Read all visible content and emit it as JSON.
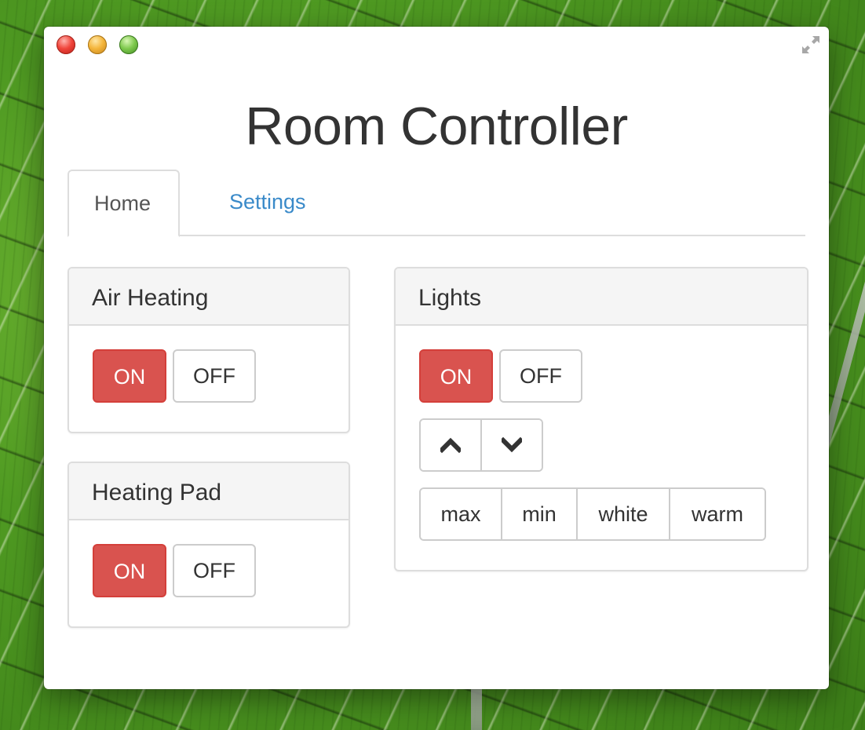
{
  "window": {
    "title": "Room Controller"
  },
  "tabs": [
    {
      "label": "Home",
      "active": true
    },
    {
      "label": "Settings",
      "active": false
    }
  ],
  "panels": {
    "air_heating": {
      "title": "Air Heating",
      "on_label": "ON",
      "off_label": "OFF"
    },
    "heating_pad": {
      "title": "Heating Pad",
      "on_label": "ON",
      "off_label": "OFF"
    },
    "lights": {
      "title": "Lights",
      "on_label": "ON",
      "off_label": "OFF",
      "brightness_controls": [
        "chevron-up-icon",
        "chevron-down-icon"
      ],
      "presets": [
        "max",
        "min",
        "white",
        "warm"
      ]
    }
  },
  "colors": {
    "on_button": "#d9534f",
    "tab_link": "#3a8ac9",
    "text": "#333333"
  }
}
